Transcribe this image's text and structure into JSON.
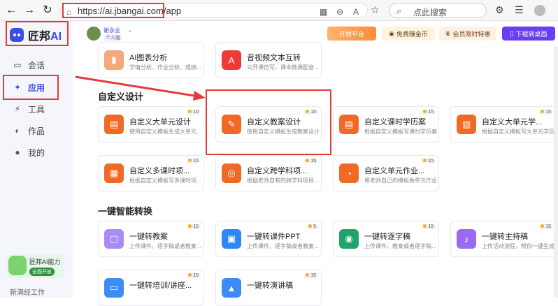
{
  "browser": {
    "url": "https://ai.jbangai.com/app",
    "search_placeholder": "点此搜索"
  },
  "brand": {
    "name": "匠邦",
    "ai": "AI"
  },
  "sidebar": {
    "items": [
      {
        "label": "会话",
        "icon": "chat-icon"
      },
      {
        "label": "应用",
        "icon": "sparkle-icon"
      },
      {
        "label": "工具",
        "icon": "bolt-icon"
      },
      {
        "label": "作品",
        "icon": "works-icon"
      },
      {
        "label": "我的",
        "icon": "user-icon"
      }
    ],
    "promo": {
      "title": "匠邦AI能力",
      "tag": "全面开放"
    },
    "bottom": "新满经工作"
  },
  "topbar": {
    "user_name": "谢永业",
    "user_tag": "个人版",
    "buttons": [
      "开放平台",
      "免费赚金币",
      "会员限时特惠",
      "下载到桌面"
    ]
  },
  "sections": [
    {
      "title": "自定义设计"
    },
    {
      "title": "一键智能转换"
    }
  ],
  "cards_top": [
    {
      "title": "AI图表分析",
      "desc": "学情分析、作业分析、成绩...",
      "color": "pink"
    },
    {
      "title": "音视频文本互转",
      "desc": "公开课仿写，课本微课配音...",
      "color": "red"
    }
  ],
  "cards_custom": [
    {
      "title": "自定义大单元设计",
      "desc": "使用自定义模板生成大单元...",
      "badge": "10",
      "color": "orange"
    },
    {
      "title": "自定义教案设计",
      "desc": "使用自定义模板生成教案设计",
      "badge": "15",
      "color": "orange"
    },
    {
      "title": "自定义课时学历案",
      "desc": "根据自定义模板写课时学历案",
      "badge": "15",
      "color": "orange"
    },
    {
      "title": "自定义大单元学...",
      "desc": "根据自定义模板写大单元学历案",
      "badge": "15",
      "color": "orange"
    },
    {
      "title": "自定义多课时项...",
      "desc": "根据自定义模板写多课时项...",
      "badge": "15",
      "color": "orange"
    },
    {
      "title": "自定义跨学科项...",
      "desc": "根据老师自有的跨学科项目...",
      "badge": "15",
      "color": "orange"
    },
    {
      "title": "自定义单元作业...",
      "desc": "用老师自己的模板做单元作业...",
      "badge": "15",
      "color": "orange"
    }
  ],
  "cards_convert": [
    {
      "title": "一键转教案",
      "desc": "上传课件、逐字稿或者教案...",
      "badge": "15",
      "color": "purple"
    },
    {
      "title": "一键转课件PPT",
      "desc": "上传课件、逐字稿或者教案...",
      "badge": "5",
      "color": "blue"
    },
    {
      "title": "一键转逐字稿",
      "desc": "上传课件、教案或者逐字稿...",
      "badge": "15",
      "color": "green"
    },
    {
      "title": "一键转主持稿",
      "desc": "上传活动流程，帮你一键生成...",
      "badge": "15",
      "color": "violet"
    },
    {
      "title": "一键转培训/讲座...",
      "desc": "",
      "badge": "15",
      "color": "ltblue"
    },
    {
      "title": "一键转演讲稿",
      "desc": "",
      "badge": "15",
      "color": "ltblue"
    }
  ]
}
